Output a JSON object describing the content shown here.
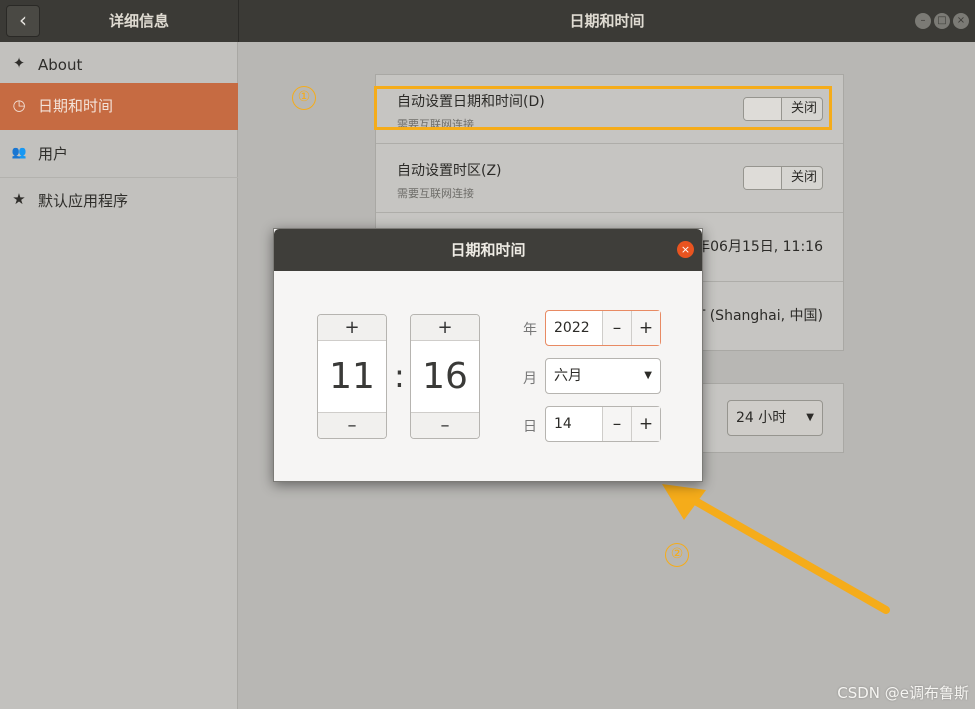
{
  "titlebar": {
    "back_glyph": "‹",
    "left_title": "详细信息",
    "main_title": "日期和时间",
    "controls": [
      "–",
      "□",
      "×"
    ]
  },
  "sidebar": {
    "items": [
      {
        "icon": "✦",
        "icon_name": "about-icon",
        "label": "About"
      },
      {
        "icon": "◷",
        "icon_name": "clock-icon",
        "label": "日期和时间"
      },
      {
        "icon": "👥",
        "icon_name": "users-icon",
        "label": "用户"
      },
      {
        "icon": "★",
        "icon_name": "star-icon",
        "label": "默认应用程序"
      }
    ],
    "active_index": 1,
    "accent": "#c66b42"
  },
  "settings": {
    "auto_datetime": {
      "title": "自动设置日期和时间(D)",
      "subtitle": "需要互联网连接",
      "state": "关闭"
    },
    "auto_timezone": {
      "title": "自动设置时区(Z)",
      "subtitle": "需要互联网连接",
      "state": "关闭"
    },
    "datetime_value": "年06月15日, 11:16",
    "timezone_value": "T (Shanghai, 中国)",
    "time_format": "24 小时"
  },
  "annotations": {
    "one": "①",
    "two": "②",
    "highlight_color": "#f5ac1a"
  },
  "dialog": {
    "title": "日期和时间",
    "close_glyph": "×",
    "hour": "11",
    "minute": "16",
    "colon": ":",
    "plus": "+",
    "minus": "–",
    "year_label": "年",
    "year_value": "2022",
    "month_label": "月",
    "month_value": "六月",
    "day_label": "日",
    "day_value": "14"
  },
  "watermark": "CSDN @e调布鲁斯"
}
